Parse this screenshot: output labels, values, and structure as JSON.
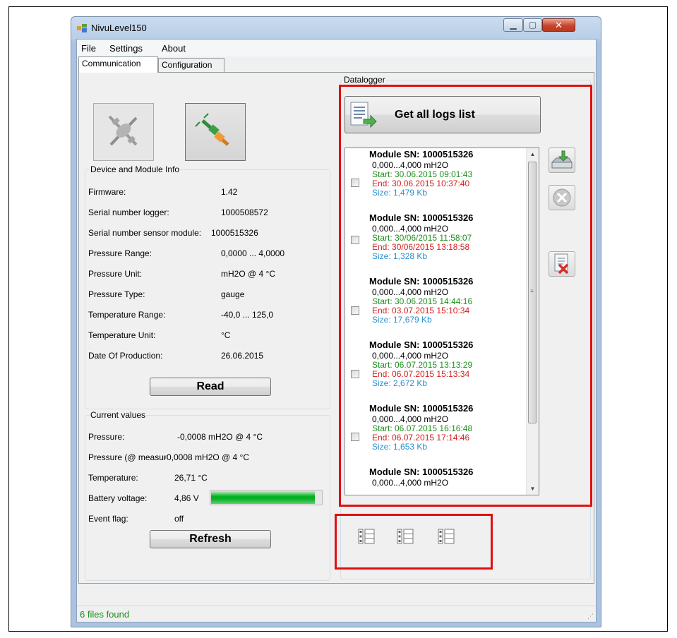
{
  "window": {
    "title": "NivuLevel150"
  },
  "menu": [
    "File",
    "Settings",
    "About"
  ],
  "tabs": [
    "Communication",
    "Configuration"
  ],
  "device_info": {
    "caption": "Device and Module Info",
    "rows": [
      {
        "label": "Firmware:",
        "value": "1.42"
      },
      {
        "label": "Serial number logger:",
        "value": "1000508572"
      },
      {
        "label": "Serial number sensor module:",
        "value": "1000515326"
      },
      {
        "label": "Pressure Range:",
        "value": "0,0000 ... 4,0000"
      },
      {
        "label": "Pressure Unit:",
        "value": "mH2O @ 4 °C"
      },
      {
        "label": "Pressure Type:",
        "value": "gauge"
      },
      {
        "label": "Temperature Range:",
        "value": "-40,0 ... 125,0"
      },
      {
        "label": "Temperature Unit:",
        "value": "°C"
      },
      {
        "label": "Date Of Production:",
        "value": "26.06.2015"
      }
    ],
    "read_label": "Read"
  },
  "current_values": {
    "caption": "Current values",
    "pressure_label": "Pressure:",
    "pressure_value": "-0,0008 mH2O @ 4 °C",
    "pressure_measure_label": "Pressure (@ measur",
    "pressure_measure_value": "-0,0008 mH2O @ 4 °C",
    "temperature_label": "Temperature:",
    "temperature_value": "26,71 °C",
    "battery_label": "Battery voltage:",
    "battery_value": "4,86 V",
    "battery_level": 0.93,
    "event_label": "Event flag:",
    "event_value": "off",
    "refresh_label": "Refresh"
  },
  "datalogger": {
    "caption": "Datalogger",
    "get_logs_label": "Get all logs list",
    "logs": [
      {
        "title": "Module SN: 1000515326",
        "range": "0,000...4,000 mH2O",
        "start": "Start: 30.06.2015 09:01:43",
        "end": "End: 30.06.2015 10:37:40",
        "size": "Size: 1,479 Kb"
      },
      {
        "title": "Module SN: 1000515326",
        "range": "0,000...4,000 mH2O",
        "start": "Start: 30/06/2015 11:58:07",
        "end": "End: 30/06/2015 13:18:58",
        "size": "Size: 1,328 Kb"
      },
      {
        "title": "Module SN: 1000515326",
        "range": "0,000...4,000 mH2O",
        "start": "Start: 30.06.2015 14:44:16",
        "end": "End: 03.07.2015 15:10:34",
        "size": "Size: 17,679 Kb"
      },
      {
        "title": "Module SN: 1000515326",
        "range": "0,000...4,000 mH2O",
        "start": "Start: 06.07.2015 13:13:29",
        "end": "End: 06.07.2015 15:13:34",
        "size": "Size: 2,672 Kb"
      },
      {
        "title": "Module SN: 1000515326",
        "range": "0,000...4,000 mH2O",
        "start": "Start: 06.07.2015 16:16:48",
        "end": "End: 06.07.2015 17:14:46",
        "size": "Size: 1,653 Kb"
      },
      {
        "title": "Module SN: 1000515326",
        "range": "0,000...4,000 mH2O",
        "start": "",
        "end": "",
        "size": ""
      }
    ]
  },
  "status": {
    "text": "6 files found"
  },
  "icons": {
    "disconnect": "disconnect-plug-icon",
    "connect": "connect-plug-icon",
    "get_logs": "document-list-icon",
    "download": "save-to-drive-icon",
    "cancel": "cancel-icon",
    "delete": "delete-file-icon",
    "view_modes": [
      "list-view-icon",
      "list-view-icon",
      "list-view-icon"
    ]
  },
  "colors": {
    "highlight": "#e01010",
    "start": "#208f20",
    "end": "#d42020",
    "size": "#2a90cf",
    "status": "#1c8f1c"
  }
}
